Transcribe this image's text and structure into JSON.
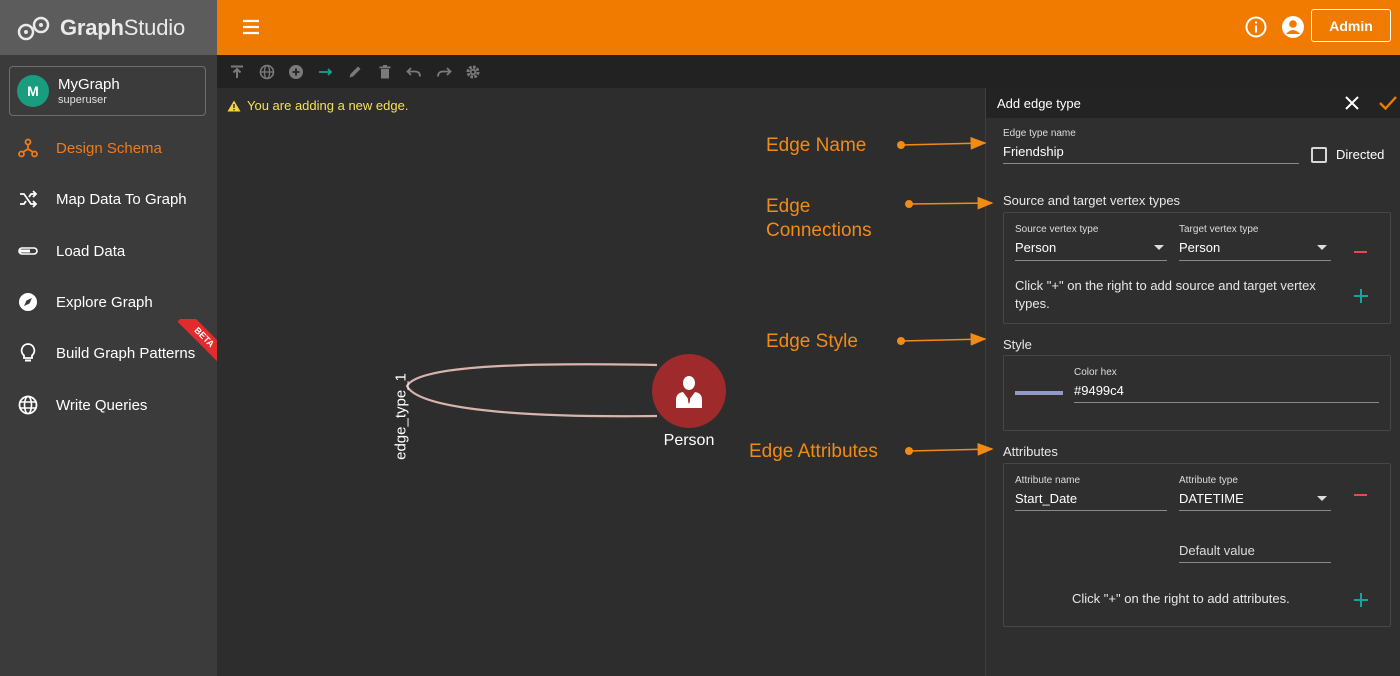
{
  "app": {
    "logo_text_bold": "Graph",
    "logo_text_light": "Studio"
  },
  "graph": {
    "avatar_letter": "M",
    "name": "MyGraph",
    "user": "superuser"
  },
  "nav": [
    {
      "label": "Design Schema",
      "icon": "schema-icon",
      "active": true
    },
    {
      "label": "Map Data To Graph",
      "icon": "shuffle-icon",
      "active": false
    },
    {
      "label": "Load Data",
      "icon": "load-icon",
      "active": false
    },
    {
      "label": "Explore Graph",
      "icon": "compass-icon",
      "active": false
    },
    {
      "label": "Build Graph Patterns",
      "icon": "lightbulb-icon",
      "active": false,
      "badge": "BETA"
    },
    {
      "label": "Write Queries",
      "icon": "globe-icon",
      "active": false
    }
  ],
  "header": {
    "admin_label": "Admin"
  },
  "toolbar": [
    "upload-icon",
    "globe-icon",
    "add-vertex-icon",
    "add-edge-icon",
    "edit-icon",
    "delete-icon",
    "undo-icon",
    "redo-icon",
    "settings-icon"
  ],
  "canvas": {
    "warning": "You are adding a new edge.",
    "edge_label": "edge_type_1",
    "vertex_label": "Person"
  },
  "annotations": {
    "edge_name": "Edge Name",
    "edge_connections_line1": "Edge",
    "edge_connections_line2": "Connections",
    "edge_style": "Edge Style",
    "edge_attributes": "Edge Attributes"
  },
  "panel": {
    "title": "Add edge type",
    "edge_type_name_label": "Edge type name",
    "edge_type_name": "Friendship",
    "directed_label": "Directed",
    "directed": false,
    "connections_title": "Source and target vertex types",
    "source_label": "Source vertex type",
    "source_value": "Person",
    "target_label": "Target vertex type",
    "target_value": "Person",
    "connections_hint": "Click \"+\" on the right to add source and target vertex types.",
    "style_title": "Style",
    "color_label": "Color hex",
    "color_value": "#9499c4",
    "attributes_title": "Attributes",
    "attr_name_label": "Attribute name",
    "attr_name": "Start_Date",
    "attr_type_label": "Attribute type",
    "attr_type": "DATETIME",
    "default_value_placeholder": "Default value",
    "attributes_hint": "Click \"+\" on the right to add attributes."
  },
  "colors": {
    "accent": "#f17b00",
    "sidebar": "#3b3b3b",
    "canvas": "#2d2d2d",
    "vertex": "#9e2a2b",
    "edge": "#d8b4ad",
    "swatch": "#9499c4",
    "minus": "#e84a4a",
    "plus": "#1aa39a",
    "beta": "#e32b2b"
  }
}
